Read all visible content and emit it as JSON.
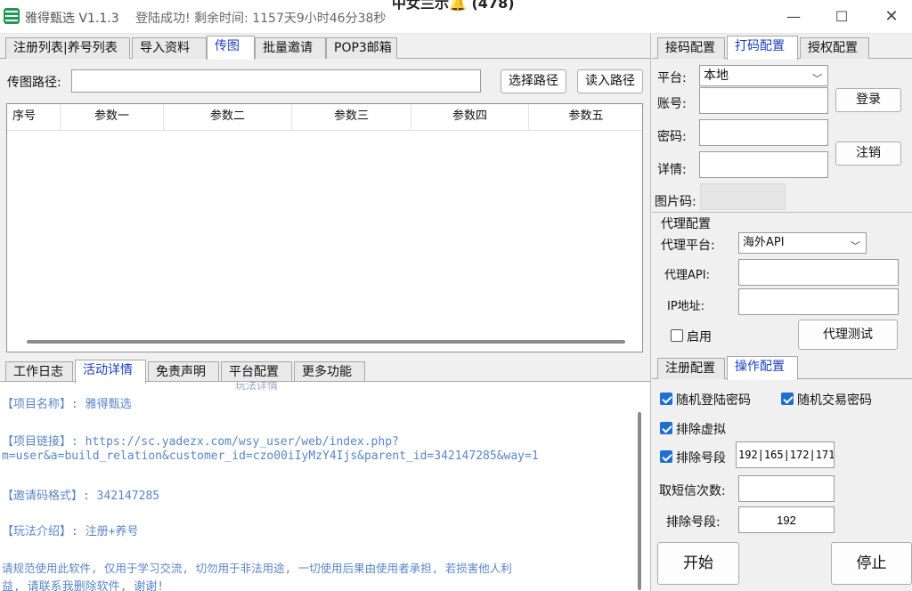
{
  "window": {
    "title": "雅得甄选 V1.1.3",
    "status": "登陆成功! 剩余时间: 1157天9小时46分38秒",
    "behind_text": "中女兰示🔔 (478)",
    "min_label": "—",
    "max_label": "☐",
    "close_label": "✕"
  },
  "top_tabs": [
    "注册列表|养号列表",
    "导入资料",
    "传图",
    "批量邀请",
    "POP3邮箱"
  ],
  "top_tab_active": "传图",
  "upload": {
    "path_label": "传图路径:",
    "path_value": "",
    "select_button": "选择路径",
    "read_button": "读入路径"
  },
  "grid": {
    "columns": [
      "序号",
      "参数一",
      "参数二",
      "参数三",
      "参数四",
      "参数五"
    ]
  },
  "bottom_tabs": [
    "工作日志",
    "活动详情",
    "免责声明",
    "平台配置",
    "更多功能"
  ],
  "bottom_tab_active": "活动详情",
  "bottom_ghost": "玩法详情",
  "log": {
    "line1": "【项目名称】: 雅得甄选",
    "line2": "【项目链接】: https://sc.yadezx.com/wsy_user/web/index.php?",
    "line3": "m=user&a=build_relation&customer_id=czo00iIyMzY4Ijs&parent_id=342147285&way=1",
    "line4": "【邀请码格式】: 342147285",
    "line5": "【玩法介绍】: 注册+养号",
    "line6": "   请规范使用此软件, 仅用于学习交流, 切勿用于非法用途, 一切使用后果由使用者承担, 若损害他人利",
    "line7": "益, 请联系我删除软件, 谢谢!"
  },
  "right_tabs": [
    "接码配置",
    "打码配置",
    "授权配置"
  ],
  "right_tab_active": "打码配置",
  "captcha": {
    "platform_label": "平台:",
    "platform_value": "本地",
    "account_label": "账号:",
    "password_label": "密码:",
    "detail_label": "详情:",
    "image_code_label": "图片码:",
    "login_button": "登录",
    "logout_button": "注销"
  },
  "proxy": {
    "group_title": "代理配置",
    "platform_label": "代理平台:",
    "platform_value": "海外API",
    "api_label": "代理API:",
    "ip_label": "IP地址:",
    "enable_label": "启用",
    "enable_checked": false,
    "test_button": "代理测试"
  },
  "ops_tabs": [
    "注册配置",
    "操作配置"
  ],
  "ops_tab_active": "操作配置",
  "ops": {
    "random_login_pwd": "随机登陆密码",
    "random_trade_pwd": "随机交易密码",
    "exclude_virtual": "排除虚拟",
    "exclude_segment": "排除号段",
    "exclude_segment_value": "192|165|172|171",
    "sms_count_label": "取短信次数:",
    "sms_count_value": "",
    "exclude_segment2_label": "排除号段:",
    "exclude_segment2_value": "192",
    "start_button": "开始",
    "stop_button": "停止"
  },
  "colors": {
    "active_tab_text": "#1a3fbf",
    "checkbox": "#1e6fd0",
    "log_text": "#5a86c8",
    "app_icon": "#1f9a55"
  }
}
